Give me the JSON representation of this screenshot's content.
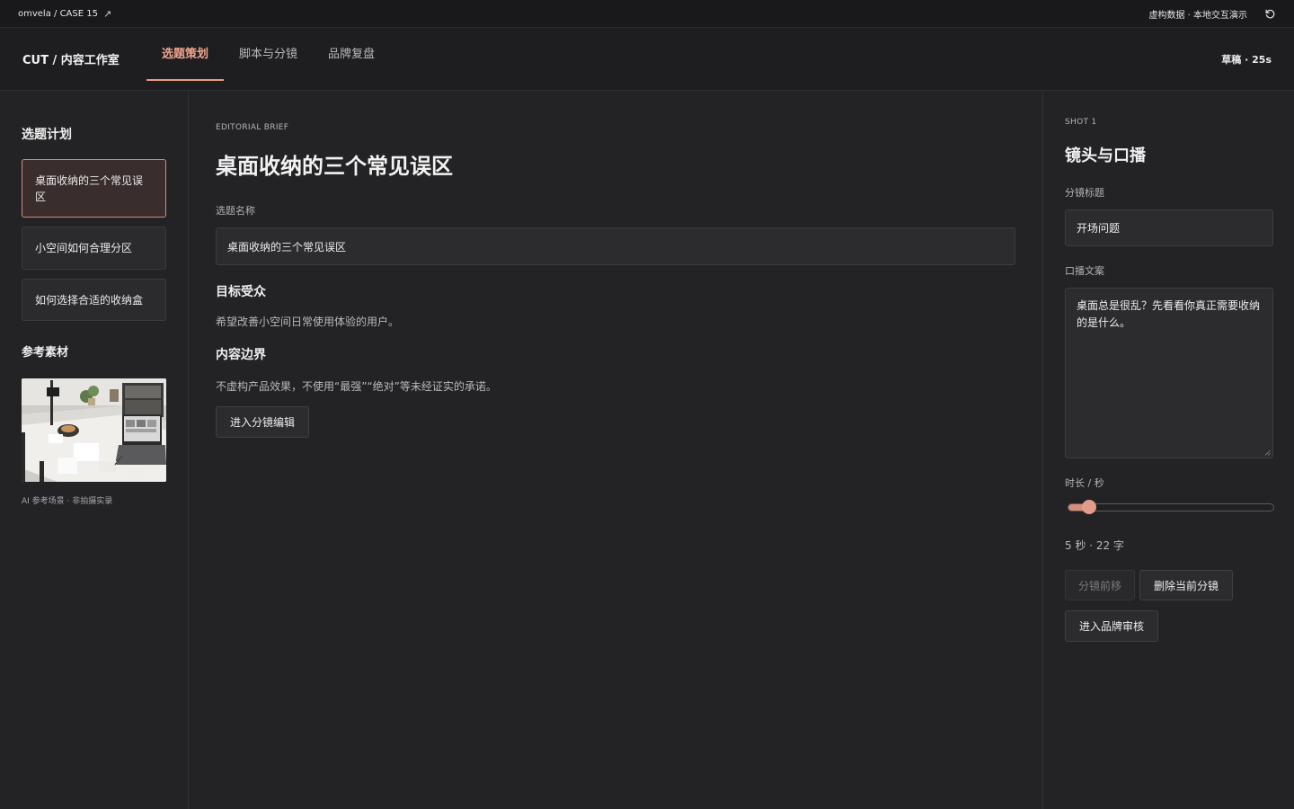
{
  "topbar": {
    "breadcrumb": "omvela / CASE 15",
    "external_icon": "arrow-up-right-icon",
    "notice": "虚构数据 · 本地交互演示",
    "reset_icon": "rotate-ccw-icon"
  },
  "app": {
    "brand": "CUT / 内容工作室",
    "tabs": [
      {
        "label": "选题策划",
        "active": true
      },
      {
        "label": "脚本与分镜",
        "active": false
      },
      {
        "label": "品牌复盘",
        "active": false
      }
    ],
    "status": "草稿 · 25s"
  },
  "sidebar": {
    "plan_title": "选题计划",
    "plans": [
      {
        "label": "桌面收纳的三个常见误区",
        "active": true
      },
      {
        "label": "小空间如何合理分区",
        "active": false
      },
      {
        "label": "如何选择合适的收纳盒",
        "active": false
      }
    ],
    "reference_title": "参考素材",
    "reference_caption": "AI 参考场景 · 非拍摄实录"
  },
  "brief": {
    "eyebrow": "EDITORIAL BRIEF",
    "title": "桌面收纳的三个常见误区",
    "name_label": "选题名称",
    "name_value": "桌面收纳的三个常见误区",
    "audience_title": "目标受众",
    "audience_text": "希望改善小空间日常使用体验的用户。",
    "boundary_title": "内容边界",
    "boundary_text": "不虚构产品效果，不使用“最强”“绝对”等未经证实的承诺。",
    "enter_button": "进入分镜编辑"
  },
  "shot": {
    "eyebrow": "SHOT 1",
    "title": "镜头与口播",
    "title_label": "分镜标题",
    "title_value": "开场问题",
    "script_label": "口播文案",
    "script_value": "桌面总是很乱？先看看你真正需要收纳的是什么。",
    "duration_label": "时长 / 秒",
    "duration_value": 5,
    "duration_fraction": 0.1,
    "stats": "5 秒 · 22 字",
    "move_button": "分镜前移",
    "delete_button": "删除当前分镜",
    "review_button": "进入品牌审核"
  },
  "colors": {
    "accent": "#e89a86",
    "background": "#232326",
    "topbar": "#19191b"
  }
}
